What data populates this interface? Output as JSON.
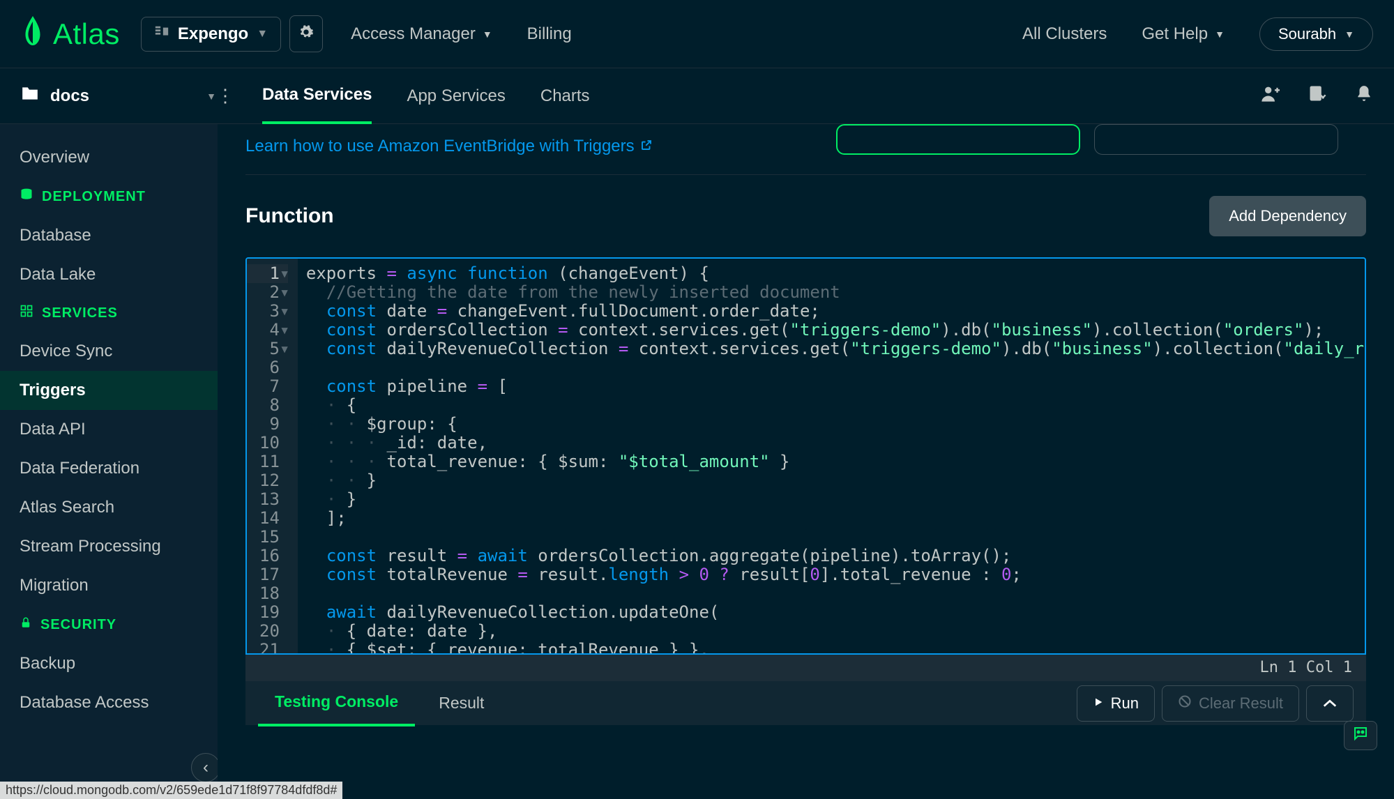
{
  "topbar": {
    "logo_text": "Atlas",
    "project_name": "Expengo",
    "access_manager": "Access Manager",
    "billing": "Billing",
    "all_clusters": "All Clusters",
    "get_help": "Get Help",
    "user_name": "Sourabh"
  },
  "secondbar": {
    "project_selector": "docs",
    "tabs": [
      "Data Services",
      "App Services",
      "Charts"
    ],
    "active_tab": 0
  },
  "sidebar": {
    "overview": "Overview",
    "deployment_heading": "DEPLOYMENT",
    "deployment_items": [
      "Database",
      "Data Lake"
    ],
    "services_heading": "SERVICES",
    "services_items": [
      "Device Sync",
      "Triggers",
      "Data API",
      "Data Federation",
      "Atlas Search",
      "Stream Processing",
      "Migration"
    ],
    "services_active": 1,
    "security_heading": "SECURITY",
    "security_items": [
      "Backup",
      "Database Access"
    ]
  },
  "banner": {
    "link_text": "Learn how to use Amazon EventBridge with Triggers"
  },
  "function_section": {
    "title": "Function",
    "add_dep_label": "Add Dependency"
  },
  "editor": {
    "line_numbers": [
      "1",
      "2",
      "3",
      "4",
      "5",
      "6",
      "7",
      "8",
      "9",
      "10",
      "11",
      "12",
      "13",
      "14",
      "15",
      "16",
      "17",
      "18",
      "19",
      "20",
      "21"
    ],
    "fold_markers": [
      "▾",
      "",
      "",
      "",
      "",
      "",
      "▾",
      "▾",
      "▾",
      "",
      "",
      "",
      "",
      "",
      "",
      "",
      "",
      "",
      "▾",
      "",
      ""
    ],
    "status": "Ln 1 Col 1",
    "code_tokens": [
      [
        {
          "t": "exports ",
          "c": ""
        },
        {
          "t": "=",
          "c": "k-purple"
        },
        {
          "t": " ",
          "c": ""
        },
        {
          "t": "async",
          "c": "k-blue"
        },
        {
          "t": " ",
          "c": ""
        },
        {
          "t": "function",
          "c": "k-blue"
        },
        {
          "t": " (changeEvent) {",
          "c": ""
        }
      ],
      [
        {
          "t": "  ",
          "c": ""
        },
        {
          "t": "//Getting the date from the newly inserted document",
          "c": "k-comment"
        }
      ],
      [
        {
          "t": "  ",
          "c": ""
        },
        {
          "t": "const",
          "c": "k-blue"
        },
        {
          "t": " date ",
          "c": ""
        },
        {
          "t": "=",
          "c": "k-purple"
        },
        {
          "t": " changeEvent.fullDocument.order_date;",
          "c": ""
        }
      ],
      [
        {
          "t": "  ",
          "c": ""
        },
        {
          "t": "const",
          "c": "k-blue"
        },
        {
          "t": " ordersCollection ",
          "c": ""
        },
        {
          "t": "=",
          "c": "k-purple"
        },
        {
          "t": " context.services.get(",
          "c": ""
        },
        {
          "t": "\"triggers-demo\"",
          "c": "k-green"
        },
        {
          "t": ").db(",
          "c": ""
        },
        {
          "t": "\"business\"",
          "c": "k-green"
        },
        {
          "t": ").collection(",
          "c": ""
        },
        {
          "t": "\"orders\"",
          "c": "k-green"
        },
        {
          "t": ");",
          "c": ""
        }
      ],
      [
        {
          "t": "  ",
          "c": ""
        },
        {
          "t": "const",
          "c": "k-blue"
        },
        {
          "t": " dailyRevenueCollection ",
          "c": ""
        },
        {
          "t": "=",
          "c": "k-purple"
        },
        {
          "t": " context.services.get(",
          "c": ""
        },
        {
          "t": "\"triggers-demo\"",
          "c": "k-green"
        },
        {
          "t": ").db(",
          "c": ""
        },
        {
          "t": "\"business\"",
          "c": "k-green"
        },
        {
          "t": ").collection(",
          "c": ""
        },
        {
          "t": "\"daily_revenu",
          "c": "k-green"
        }
      ],
      [
        {
          "t": "",
          "c": ""
        }
      ],
      [
        {
          "t": "  ",
          "c": ""
        },
        {
          "t": "const",
          "c": "k-blue"
        },
        {
          "t": " pipeline ",
          "c": ""
        },
        {
          "t": "=",
          "c": "k-purple"
        },
        {
          "t": " [",
          "c": ""
        }
      ],
      [
        {
          "t": "  ",
          "c": ""
        },
        {
          "t": "·",
          "c": "indent-guide"
        },
        {
          "t": " {",
          "c": ""
        }
      ],
      [
        {
          "t": "  ",
          "c": ""
        },
        {
          "t": "·",
          "c": "indent-guide"
        },
        {
          "t": " ",
          "c": ""
        },
        {
          "t": "·",
          "c": "indent-guide"
        },
        {
          "t": " $group: {",
          "c": ""
        }
      ],
      [
        {
          "t": "  ",
          "c": ""
        },
        {
          "t": "·",
          "c": "indent-guide"
        },
        {
          "t": " ",
          "c": ""
        },
        {
          "t": "·",
          "c": "indent-guide"
        },
        {
          "t": " ",
          "c": ""
        },
        {
          "t": "·",
          "c": "indent-guide"
        },
        {
          "t": " _id: date,",
          "c": ""
        }
      ],
      [
        {
          "t": "  ",
          "c": ""
        },
        {
          "t": "·",
          "c": "indent-guide"
        },
        {
          "t": " ",
          "c": ""
        },
        {
          "t": "·",
          "c": "indent-guide"
        },
        {
          "t": " ",
          "c": ""
        },
        {
          "t": "·",
          "c": "indent-guide"
        },
        {
          "t": " total_revenue: { $sum: ",
          "c": ""
        },
        {
          "t": "\"$total_amount\"",
          "c": "k-green"
        },
        {
          "t": " }",
          "c": ""
        }
      ],
      [
        {
          "t": "  ",
          "c": ""
        },
        {
          "t": "·",
          "c": "indent-guide"
        },
        {
          "t": " ",
          "c": ""
        },
        {
          "t": "·",
          "c": "indent-guide"
        },
        {
          "t": " }",
          "c": ""
        }
      ],
      [
        {
          "t": "  ",
          "c": ""
        },
        {
          "t": "·",
          "c": "indent-guide"
        },
        {
          "t": " }",
          "c": ""
        }
      ],
      [
        {
          "t": "  ];",
          "c": ""
        }
      ],
      [
        {
          "t": "",
          "c": ""
        }
      ],
      [
        {
          "t": "  ",
          "c": ""
        },
        {
          "t": "const",
          "c": "k-blue"
        },
        {
          "t": " result ",
          "c": ""
        },
        {
          "t": "=",
          "c": "k-purple"
        },
        {
          "t": " ",
          "c": ""
        },
        {
          "t": "await",
          "c": "k-blue"
        },
        {
          "t": " ordersCollection.aggregate(pipeline).toArray();",
          "c": ""
        }
      ],
      [
        {
          "t": "  ",
          "c": ""
        },
        {
          "t": "const",
          "c": "k-blue"
        },
        {
          "t": " totalRevenue ",
          "c": ""
        },
        {
          "t": "=",
          "c": "k-purple"
        },
        {
          "t": " result.",
          "c": ""
        },
        {
          "t": "length",
          "c": "k-blue"
        },
        {
          "t": " ",
          "c": ""
        },
        {
          "t": ">",
          "c": "k-purple"
        },
        {
          "t": " ",
          "c": ""
        },
        {
          "t": "0",
          "c": "k-num"
        },
        {
          "t": " ",
          "c": ""
        },
        {
          "t": "?",
          "c": "k-purple"
        },
        {
          "t": " result[",
          "c": ""
        },
        {
          "t": "0",
          "c": "k-num"
        },
        {
          "t": "].total_revenue : ",
          "c": ""
        },
        {
          "t": "0",
          "c": "k-num"
        },
        {
          "t": ";",
          "c": ""
        }
      ],
      [
        {
          "t": "",
          "c": ""
        }
      ],
      [
        {
          "t": "  ",
          "c": ""
        },
        {
          "t": "await",
          "c": "k-blue"
        },
        {
          "t": " dailyRevenueCollection.updateOne(",
          "c": ""
        }
      ],
      [
        {
          "t": "  ",
          "c": ""
        },
        {
          "t": "·",
          "c": "indent-guide"
        },
        {
          "t": " { date: date },",
          "c": ""
        }
      ],
      [
        {
          "t": "  ",
          "c": ""
        },
        {
          "t": "·",
          "c": "indent-guide"
        },
        {
          "t": " { $set: { revenue: totalRevenue } },",
          "c": ""
        }
      ]
    ]
  },
  "console": {
    "tabs": [
      "Testing Console",
      "Result"
    ],
    "active_tab": 0,
    "run_label": "Run",
    "clear_label": "Clear Result"
  },
  "status_url": "https://cloud.mongodb.com/v2/659ede1d71f8f97784dfdf8d#"
}
